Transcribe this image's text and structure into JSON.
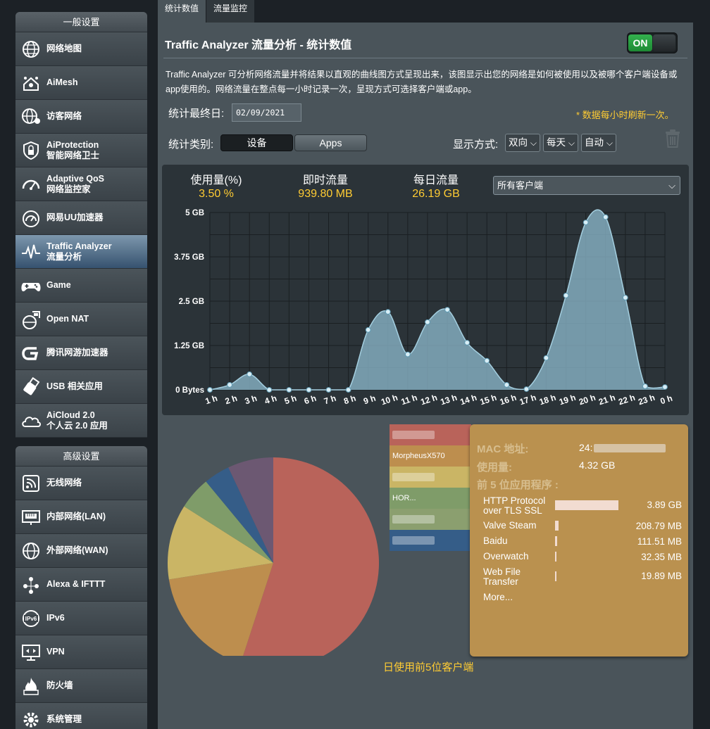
{
  "sidebar": {
    "general_title": "一般设置",
    "general_items": [
      {
        "label": "网络地图",
        "icon": "globe-map-icon"
      },
      {
        "label": "AiMesh",
        "icon": "aimesh-icon"
      },
      {
        "label": "访客网络",
        "icon": "guest-globe-icon"
      },
      {
        "label": "AiProtection\n智能网络卫士",
        "icon": "shield-lock-icon"
      },
      {
        "label": "Adaptive QoS\n网络监控家",
        "icon": "speedometer-icon"
      },
      {
        "label": "网易UU加速器",
        "icon": "uu-gauge-icon"
      },
      {
        "label": "Traffic Analyzer\n流量分析",
        "icon": "traffic-pulse-icon"
      },
      {
        "label": "Game",
        "icon": "gamepad-icon"
      },
      {
        "label": "Open NAT",
        "icon": "open-nat-icon"
      },
      {
        "label": "腾讯网游加速器",
        "icon": "tencent-g-icon"
      },
      {
        "label": "USB 相关应用",
        "icon": "usb-icon"
      },
      {
        "label": "AiCloud 2.0\n个人云 2.0 应用",
        "icon": "cloud-icon"
      }
    ],
    "advanced_title": "高级设置",
    "advanced_items": [
      {
        "label": "无线网络",
        "icon": "wifi-icon"
      },
      {
        "label": "内部网络(LAN)",
        "icon": "lan-icon"
      },
      {
        "label": "外部网络(WAN)",
        "icon": "wan-globe-icon"
      },
      {
        "label": "Alexa & IFTTT",
        "icon": "alexa-icon"
      },
      {
        "label": "IPv6",
        "icon": "ipv6-globe-icon"
      },
      {
        "label": "VPN",
        "icon": "vpn-monitor-icon"
      },
      {
        "label": "防火墙",
        "icon": "firewall-icon"
      },
      {
        "label": "系统管理",
        "icon": "admin-gear-icon"
      }
    ]
  },
  "tabs": [
    "统计数值",
    "流量监控"
  ],
  "heading": "Traffic Analyzer 流量分析 - 统计数值",
  "toggle_label": "ON",
  "description": "Traffic Analyzer 可分析网络流量并将结果以直观的曲线图方式呈现出来，该图显示出您的网络是如何被使用以及被哪个客户端设备或app使用的。网络流量在整点每一小时记录一次，呈现方式可选择客户端或app。",
  "end_date_label": "统计最终日:",
  "end_date_value": "02/09/2021",
  "refresh_note": "* 数据每小时刷新一次。",
  "category_label": "统计类别:",
  "category_buttons": [
    "设备",
    "Apps"
  ],
  "display_label": "显示方式:",
  "display_selects": [
    "双向",
    "每天",
    "自动"
  ],
  "stats": {
    "usage_label": "使用量(%)",
    "usage_value": "3.50 %",
    "instant_label": "即时流量",
    "instant_value": "939.80 MB",
    "daily_label": "每日流量",
    "daily_value": "26.19 GB"
  },
  "client_select": "所有客户端",
  "chart_data": {
    "type": "area",
    "x": [
      "1 h",
      "2 h",
      "3 h",
      "4 h",
      "5 h",
      "6 h",
      "7 h",
      "8 h",
      "9 h",
      "10 h",
      "11 h",
      "12 h",
      "13 h",
      "14 h",
      "15 h",
      "16 h",
      "17 h",
      "18 h",
      "19 h",
      "20 h",
      "21 h",
      "22 h",
      "23 h",
      "0 h"
    ],
    "y_ticks": [
      "0 Bytes",
      "1.25 GB",
      "2.5 GB",
      "3.75 GB",
      "5 GB"
    ],
    "ylim": [
      0,
      5
    ],
    "unit": "GB",
    "series": [
      {
        "values": [
          0.0,
          0.14,
          0.44,
          0.0,
          0.0,
          0.0,
          0.0,
          0.0,
          1.69,
          2.2,
          1.0,
          1.91,
          2.26,
          1.33,
          0.82,
          0.14,
          0.02,
          0.9,
          2.66,
          4.72,
          4.87,
          2.6,
          0.1,
          0.08
        ]
      }
    ],
    "grid": true,
    "color": "#8ab6c9"
  },
  "pie_data": {
    "type": "pie",
    "caption": "日使用前5位客户端",
    "slices": [
      {
        "value": 55.0,
        "color": "#b9635a"
      },
      {
        "value": 17.5,
        "color": "#bd8e4e"
      },
      {
        "value": 11.5,
        "color": "#cab565"
      },
      {
        "value": 5.0,
        "color": "#7f9c69"
      },
      {
        "value": 4.0,
        "color": "#355d88"
      },
      {
        "value": 7.0,
        "color": "#6c5872"
      }
    ]
  },
  "legend_items": [
    {
      "label": "",
      "color": "#b9635a"
    },
    {
      "label": "MorpheusX570",
      "color": "#bd8e4e"
    },
    {
      "label": "",
      "color": "#cab565"
    },
    {
      "label": "HOR...",
      "color": "#7f9c69"
    },
    {
      "label": "",
      "color": "#8b9f6f"
    },
    {
      "label": "",
      "color": "#355d88"
    }
  ],
  "tooltip": {
    "mac_label": "MAC 地址:",
    "mac_value": "24:",
    "usage_label": "使用量:",
    "usage_value": "4.32 GB",
    "apps_label": "前 5 位应用程序 :",
    "apps": [
      {
        "name": "HTTP Protocol\nover TLS SSL",
        "value": "3.89 GB",
        "fraction": 0.9
      },
      {
        "name": "Valve Steam",
        "value": "208.79 MB",
        "fraction": 0.048
      },
      {
        "name": "Baidu",
        "value": "111.51 MB",
        "fraction": 0.026
      },
      {
        "name": "Overwatch",
        "value": "32.35 MB",
        "fraction": 0.0075
      },
      {
        "name": "Web File\nTransfer",
        "value": "19.89 MB",
        "fraction": 0.0046
      }
    ],
    "more": "More..."
  }
}
